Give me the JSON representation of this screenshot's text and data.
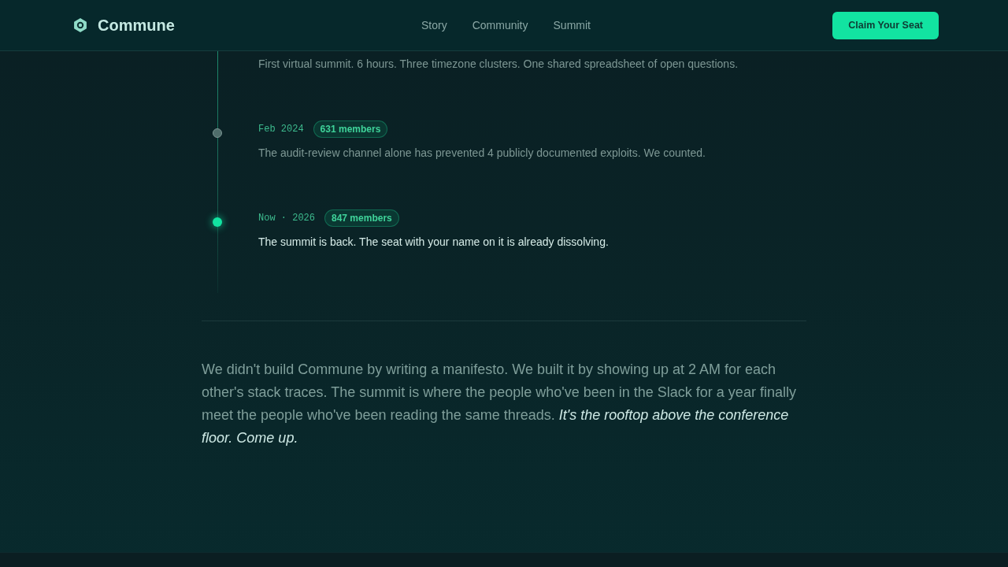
{
  "header": {
    "logo": "Commune",
    "nav": [
      "Story",
      "Community",
      "Summit"
    ],
    "cta": "Claim Your Seat"
  },
  "timeline": {
    "items": [
      {
        "description": "First virtual summit. 6 hours. Three timezone clusters. One shared spreadsheet of open questions.",
        "current": false
      },
      {
        "date": "Feb 2024",
        "members": "631 members",
        "description": "The audit-review channel alone has prevented 4 publicly documented exploits. We counted.",
        "current": false
      },
      {
        "date": "Now · 2026",
        "members": "847 members",
        "description": "The summit is back. The seat with your name on it is already dissolving.",
        "current": true
      }
    ]
  },
  "closing": {
    "text": "We didn't build Commune by writing a manifesto. We built it by showing up at 2 AM for each other's stack traces. The summit is where the people who've been in the Slack for a year finally meet the people who've been reading the same threads. *It's the rooftop above the conference floor. Come up.*"
  }
}
